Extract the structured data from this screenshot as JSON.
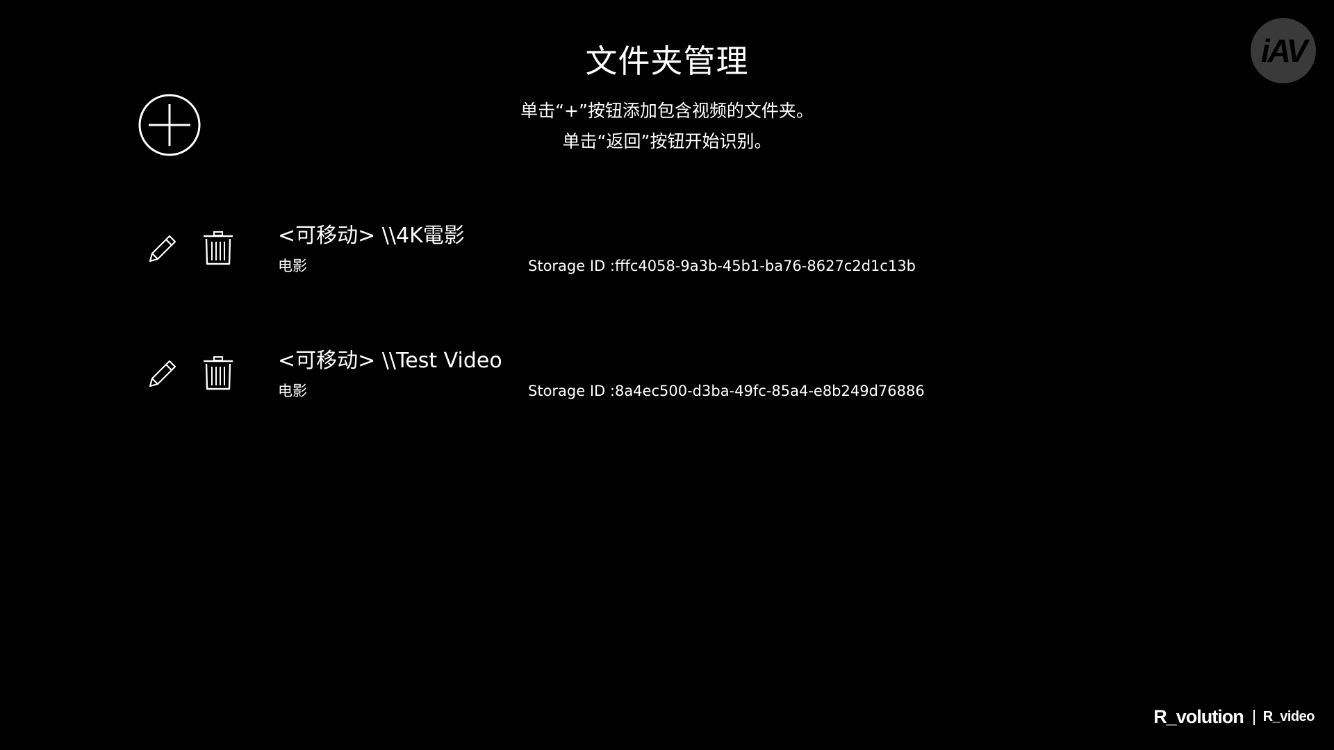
{
  "header": {
    "title": "文件夹管理",
    "instruction_line1": "单击“+”按钮添加包含视频的文件夹。",
    "instruction_line2": "单击“返回”按钮开始识别。"
  },
  "logo": {
    "text": "iAV"
  },
  "folders": [
    {
      "name": "<可移动> \\\\4K電影",
      "type": "电影",
      "storage_id": "Storage ID :fffc4058-9a3b-45b1-ba76-8627c2d1c13b"
    },
    {
      "name": "<可移动> \\\\Test Video",
      "type": "电影",
      "storage_id": "Storage ID :8a4ec500-d3ba-49fc-85a4-e8b249d76886"
    }
  ],
  "brand": {
    "primary": "R_volution",
    "secondary": "R_video"
  },
  "icons": {
    "add": "plus-circle-icon",
    "edit": "pencil-icon",
    "delete": "trash-icon"
  },
  "colors": {
    "background": "#000000",
    "foreground": "#ffffff",
    "logo_badge": "#3a3a3a"
  }
}
